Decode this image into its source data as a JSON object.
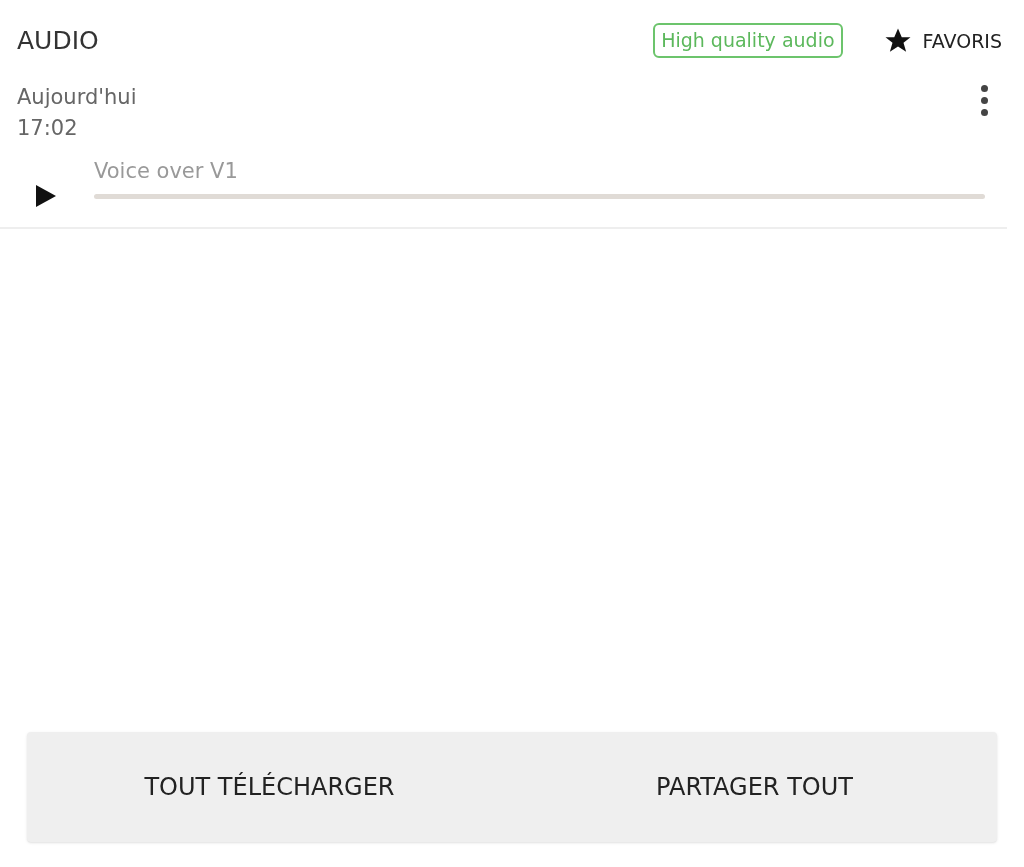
{
  "header": {
    "title": "AUDIO",
    "badge": "High quality audio",
    "favorites": "FAVORIS"
  },
  "recording": {
    "date": "Aujourd'hui",
    "time": "17:02",
    "name": "Voice over V1",
    "level": 0
  },
  "actions": [
    "TOUT TÉLÉCHARGER",
    "PARTAGER TOUT"
  ]
}
